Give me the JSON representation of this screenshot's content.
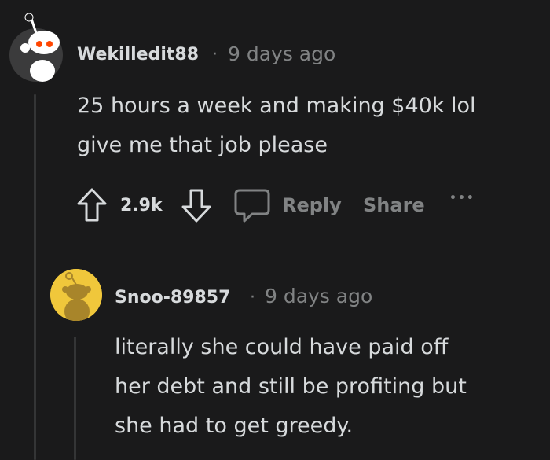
{
  "comment1": {
    "username": "Wekilledit88",
    "separator": "·",
    "timestamp": "9 days ago",
    "body_lines": [
      "25 hours a week and making $40k lol",
      "give me that job please"
    ],
    "score": "2.9k",
    "reply_label": "Reply",
    "share_label": "Share",
    "more_label": "•••",
    "avatar_colors": {
      "bg": "#ffffff",
      "accent": "#ff4500",
      "dark": "#1a1a1b"
    }
  },
  "comment2": {
    "username": "Snoo-89857",
    "separator": "·",
    "timestamp": "9 days ago",
    "body_lines": [
      "literally she could have paid off",
      "her debt and still be profiting but",
      "she had to get greedy."
    ],
    "avatar_colors": {
      "bg": "#f0c73b",
      "body": "#a8852a"
    }
  },
  "icons": {
    "upvote": "arrow-up-icon",
    "downvote": "arrow-down-icon",
    "reply": "speech-bubble-icon"
  }
}
